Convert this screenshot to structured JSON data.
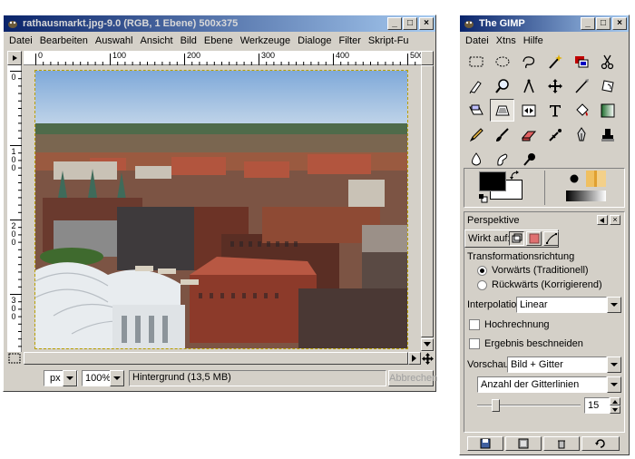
{
  "image_window": {
    "title": "rathausmarkt.jpg-9.0 (RGB, 1 Ebene) 500x375",
    "menu": [
      "Datei",
      "Bearbeiten",
      "Auswahl",
      "Ansicht",
      "Bild",
      "Ebene",
      "Werkzeuge",
      "Dialoge",
      "Filter",
      "Skript-Fu"
    ],
    "ruler_h_labels": [
      "0",
      "100",
      "200",
      "300",
      "400",
      "500"
    ],
    "ruler_v_labels": [
      "0",
      "100",
      "200",
      "300"
    ],
    "status": {
      "unit": "px",
      "zoom": "100%",
      "info": "Hintergrund (13,5 MB)",
      "cancel": "Abbrechen"
    }
  },
  "toolbox_window": {
    "title": "The GIMP",
    "menu": [
      "Datei",
      "Xtns",
      "Hilfe"
    ],
    "colors": {
      "foreground": "#000000",
      "background": "#ffffff"
    }
  },
  "options": {
    "title": "Perspektive",
    "affects_label": "Wirkt auf:",
    "direction_label": "Transformationsrichtung",
    "direction_options": [
      "Vorwärts (Traditionell)",
      "Rückwärts (Korrigierend)"
    ],
    "direction_selected": 0,
    "interpolation_label": "Interpolation:",
    "interpolation_value": "Linear",
    "supersample_label": "Hochrechnung",
    "clip_label": "Ergebnis beschneiden",
    "preview_label": "Vorschau:",
    "preview_value": "Bild + Gitter",
    "grid_mode_value": "Anzahl der Gitterlinien",
    "grid_count": "15",
    "grid_slider_fraction": 0.15
  }
}
